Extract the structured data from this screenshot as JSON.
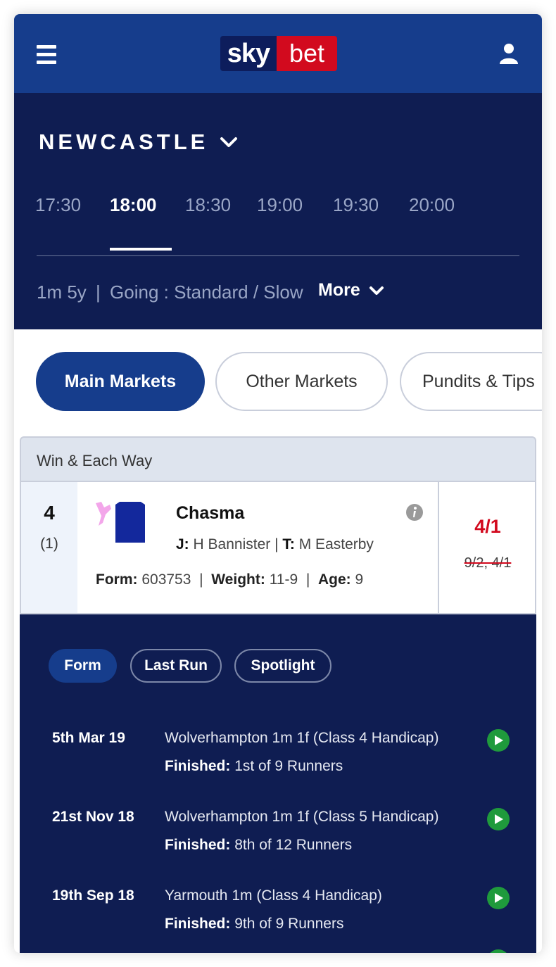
{
  "brand": {
    "sky": "sky",
    "bet": "bet",
    "primary": "#163d8c",
    "red": "#d20a1e"
  },
  "header": {
    "course": "NEWCASTLE",
    "times": [
      "17:30",
      "18:00",
      "18:30",
      "19:00",
      "19:30",
      "20:00"
    ],
    "active_time": "18:00",
    "distance": "1m 5y",
    "separator": "|",
    "going": "Going : Standard / Slow",
    "more_label": "More"
  },
  "markets": {
    "tabs": [
      "Main Markets",
      "Other Markets",
      "Pundits & Tips"
    ],
    "active": "Main Markets"
  },
  "market": {
    "title": "Win & Each Way",
    "runner": {
      "number": "4",
      "draw": "(1)",
      "name": "Chasma",
      "jockey_label": "J:",
      "jockey": "H Bannister",
      "trainer_label": "T:",
      "trainer": "M Easterby",
      "form_label": "Form:",
      "form": "603753",
      "weight_label": "Weight:",
      "weight": "11-9",
      "age_label": "Age:",
      "age": "9",
      "odds": "4/1",
      "previous_odds": "9/2, 4/1"
    }
  },
  "form_panel": {
    "tabs": [
      "Form",
      "Last Run",
      "Spotlight"
    ],
    "active": "Form",
    "finished_label": "Finished:",
    "rows": [
      {
        "date": "5th Mar 19",
        "race": "Wolverhampton 1m 1f (Class 4 Handicap)",
        "result": "1st of 9 Runners"
      },
      {
        "date": "21st Nov 18",
        "race": "Wolverhampton 1m 1f (Class 5 Handicap)",
        "result": "8th of 12 Runners"
      },
      {
        "date": "19th Sep 18",
        "race": "Yarmouth 1m (Class 4 Handicap)",
        "result": "9th of 9 Runners"
      }
    ]
  }
}
